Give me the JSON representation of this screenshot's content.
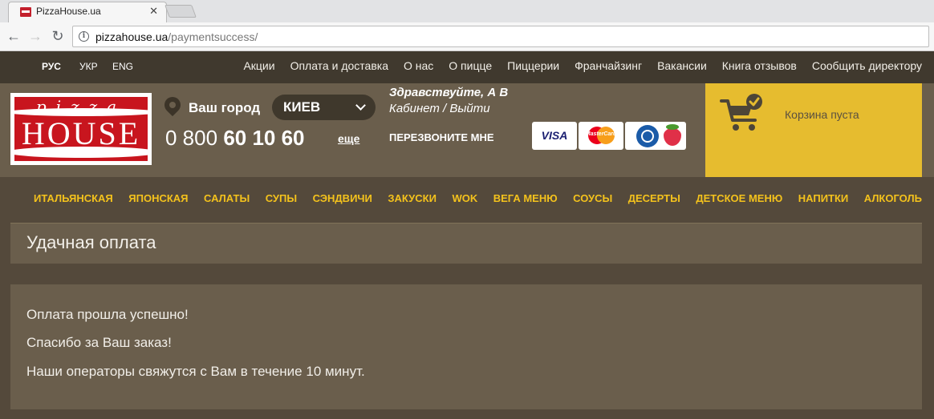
{
  "browser": {
    "tab_title": "PizzaHouse.ua",
    "url_domain": "pizzahouse.ua",
    "url_path": "/paymentsuccess/"
  },
  "topbar": {
    "languages": [
      "РУС",
      "УКР",
      "ENG"
    ],
    "links": [
      "Акции",
      "Оплата и доставка",
      "О нас",
      "О пицце",
      "Пиццерии",
      "Франчайзинг",
      "Вакансии",
      "Книга отзывов",
      "Сообщить директору"
    ]
  },
  "logo": {
    "top": "pizza",
    "bottom": "HOUSE"
  },
  "header": {
    "city_label": "Ваш город",
    "city_value": "КИЕВ",
    "phone_prefix": "0 800",
    "phone_main": "60 10 60",
    "more_link": "еще",
    "greeting": "Здравствуйте, А В",
    "cabinet": "Кабинет / Выйти",
    "callback": "ПЕРЕЗВОНИТЕ МНЕ",
    "payments": [
      "VISA",
      "MasterCard",
      "WebMoney",
      "Ягода"
    ],
    "cart_text": "Корзина пуста"
  },
  "categories": [
    "ИТАЛЬЯНСКАЯ",
    "ЯПОНСКАЯ",
    "САЛАТЫ",
    "СУПЫ",
    "СЭНДВИЧИ",
    "ЗАКУСКИ",
    "WOK",
    "ВЕГА МЕНЮ",
    "СОУСЫ",
    "ДЕСЕРТЫ",
    "ДЕТСКОЕ МЕНЮ",
    "НАПИТКИ",
    "АЛКОГОЛЬ"
  ],
  "content": {
    "title": "Удачная оплата",
    "messages": [
      "Оплата прошла успешно!",
      "Спасибо за Ваш заказ!",
      "Наши операторы свяжутся с Вам в течение 10 минут."
    ]
  }
}
